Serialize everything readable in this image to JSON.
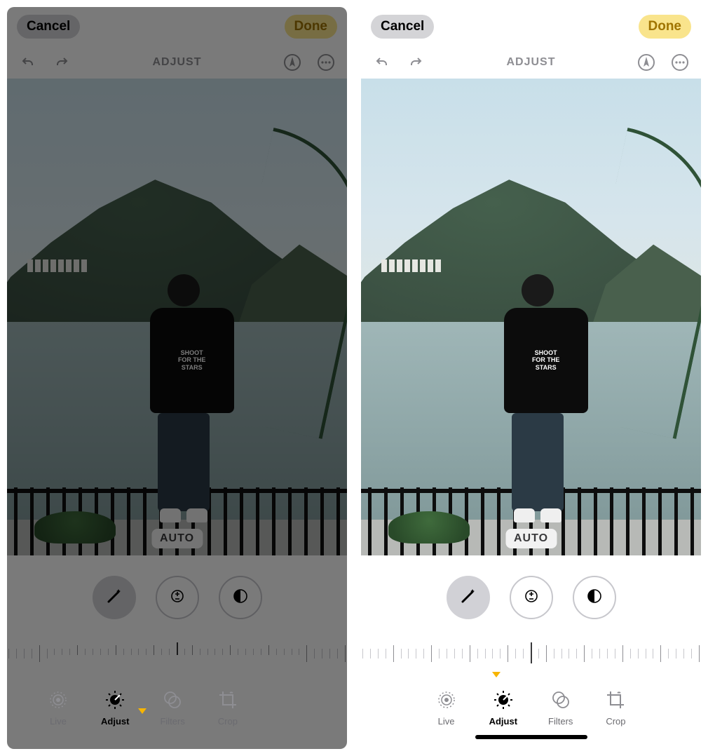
{
  "shared": {
    "cancel_label": "Cancel",
    "done_label": "Done",
    "section_title": "ADJUST",
    "auto_badge": "AUTO",
    "tabs": {
      "live": "Live",
      "adjust": "Adjust",
      "filters": "Filters",
      "crop": "Crop"
    },
    "tshirt_line1": "SHOOT",
    "tshirt_line2": "FOR THE",
    "tshirt_line3": "STARS",
    "tool_icons": {
      "wand": "auto-enhance",
      "exposure": "exposure",
      "brilliance": "brilliance"
    },
    "active_tab": "adjust",
    "active_tool": "wand",
    "colors": {
      "done_bg": "#f9e48c",
      "done_fg": "#a07400",
      "indicator": "#f7b500"
    }
  }
}
